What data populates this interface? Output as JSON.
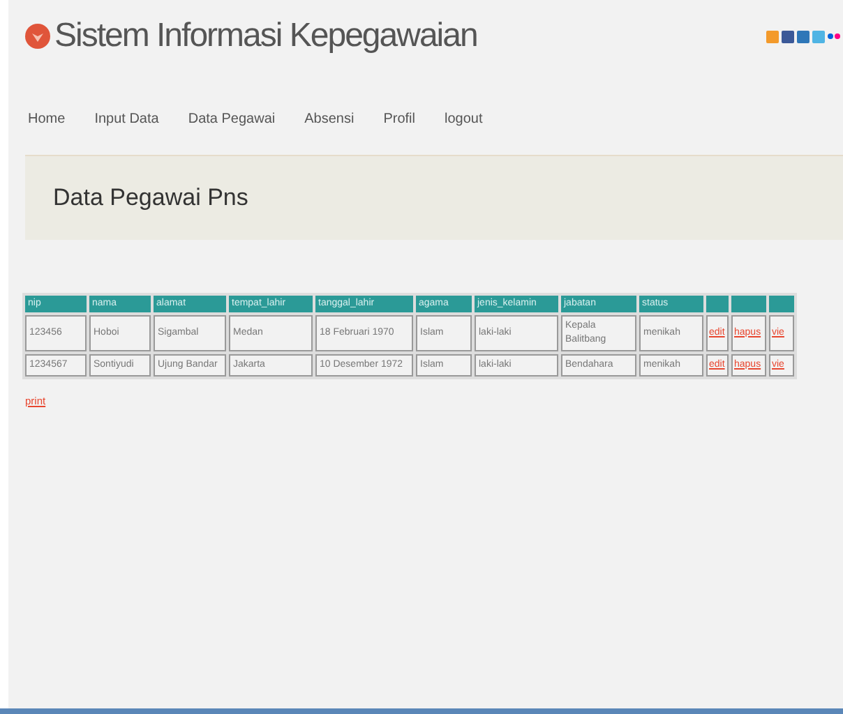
{
  "header": {
    "title": "Sistem Informasi Kepegawaian"
  },
  "nav": [
    {
      "label": "Home"
    },
    {
      "label": "Input Data"
    },
    {
      "label": "Data Pegawai"
    },
    {
      "label": "Absensi"
    },
    {
      "label": "Profil"
    },
    {
      "label": "logout"
    }
  ],
  "banner": {
    "title": "Data Pegawai Pns"
  },
  "table": {
    "columns": [
      "nip",
      "nama",
      "alamat",
      "tempat_lahir",
      "tanggal_lahir",
      "agama",
      "jenis_kelamin",
      "jabatan",
      "status"
    ],
    "rows": [
      {
        "cells": [
          "123456",
          "Hoboi",
          "Sigambal",
          "Medan",
          "18 Februari 1970",
          "Islam",
          "laki-laki",
          "Kepala Balitbang",
          "menikah"
        ],
        "actions": [
          "edit",
          "hapus",
          "vie"
        ]
      },
      {
        "cells": [
          "1234567",
          "Sontiyudi",
          "Ujung Bandar",
          "Jakarta",
          "10 Desember 1972",
          "Islam",
          "laki-laki",
          "Bendahara",
          "menikah"
        ],
        "actions": [
          "edit",
          "hapus",
          "vie"
        ]
      }
    ]
  },
  "print_link": "print"
}
